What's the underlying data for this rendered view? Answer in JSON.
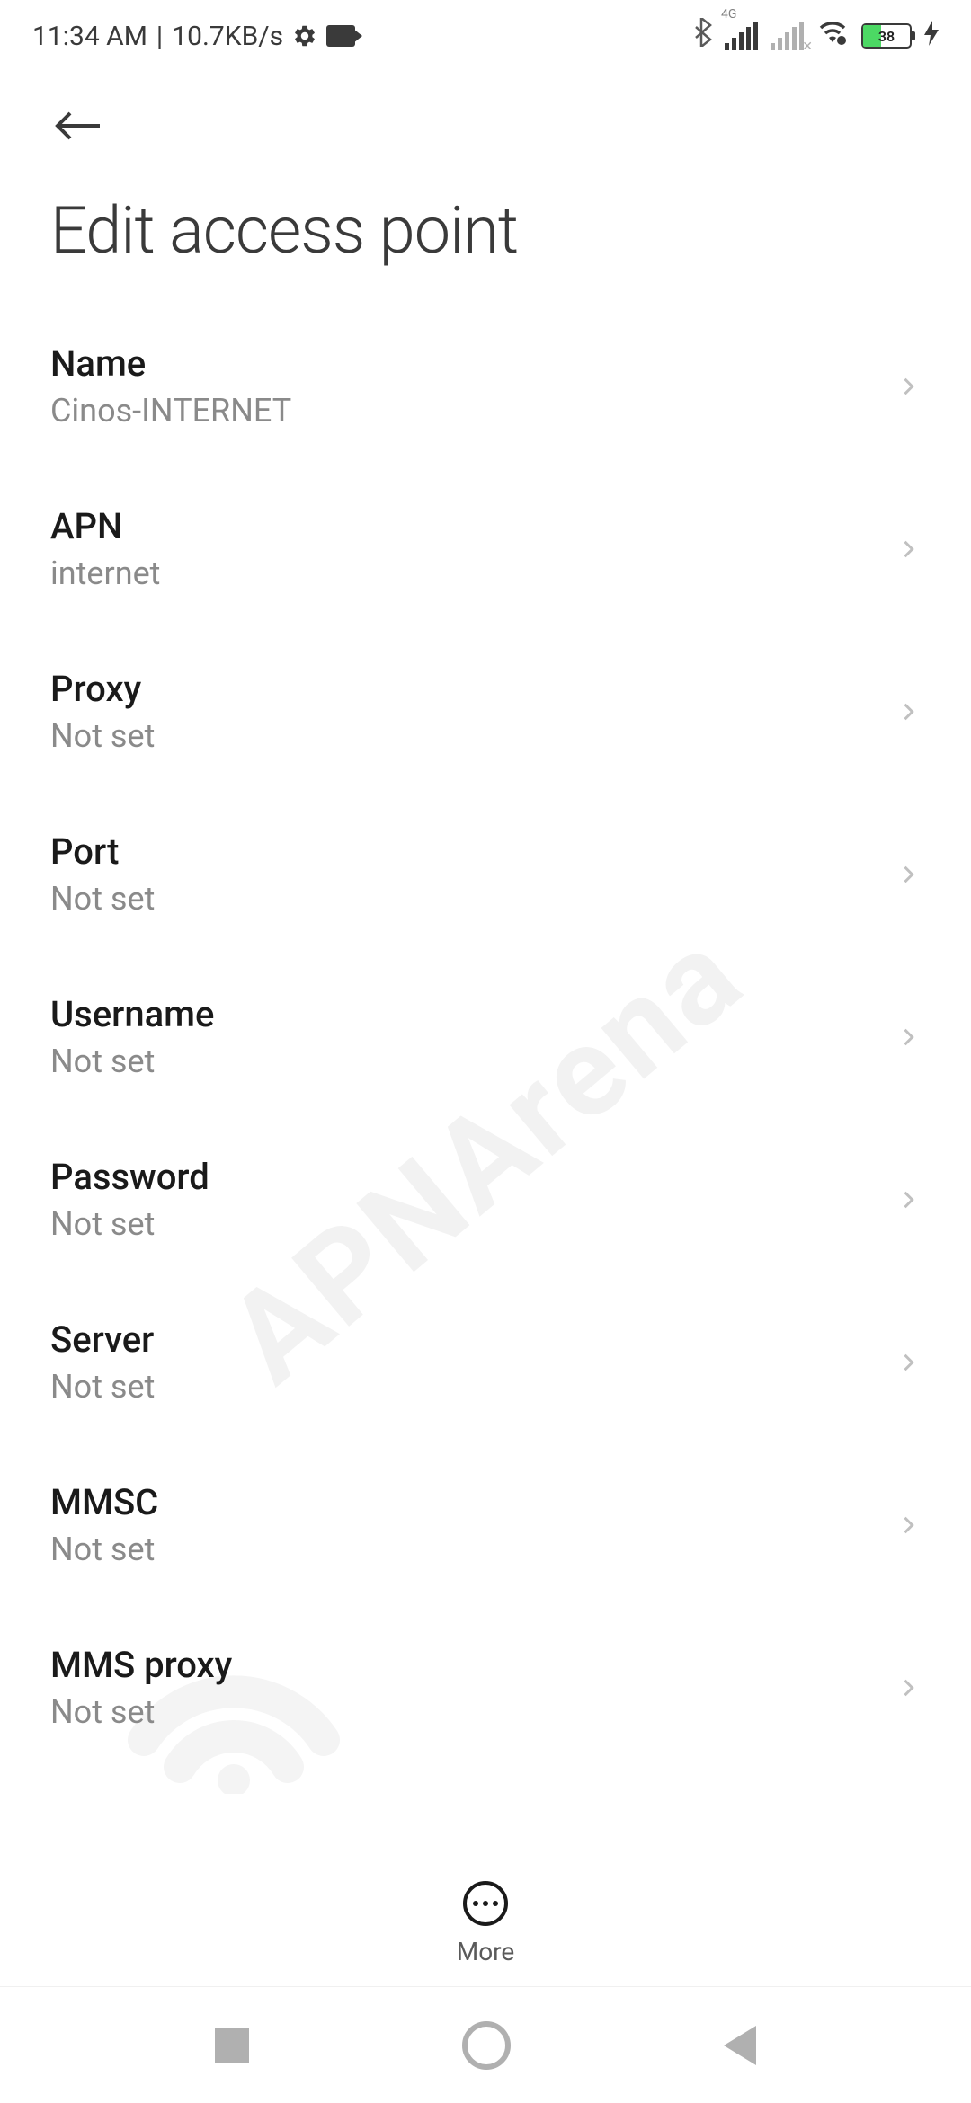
{
  "status_bar": {
    "time": "11:34 AM",
    "separator": "|",
    "network_speed": "10.7KB/s",
    "signal_type": "4G",
    "battery_percent": "38"
  },
  "header": {
    "title": "Edit access point"
  },
  "settings": [
    {
      "label": "Name",
      "value": "Cinos-INTERNET"
    },
    {
      "label": "APN",
      "value": "internet"
    },
    {
      "label": "Proxy",
      "value": "Not set"
    },
    {
      "label": "Port",
      "value": "Not set"
    },
    {
      "label": "Username",
      "value": "Not set"
    },
    {
      "label": "Password",
      "value": "Not set"
    },
    {
      "label": "Server",
      "value": "Not set"
    },
    {
      "label": "MMSC",
      "value": "Not set"
    },
    {
      "label": "MMS proxy",
      "value": "Not set"
    }
  ],
  "toolbar": {
    "more_label": "More"
  },
  "watermark": "APNArena"
}
